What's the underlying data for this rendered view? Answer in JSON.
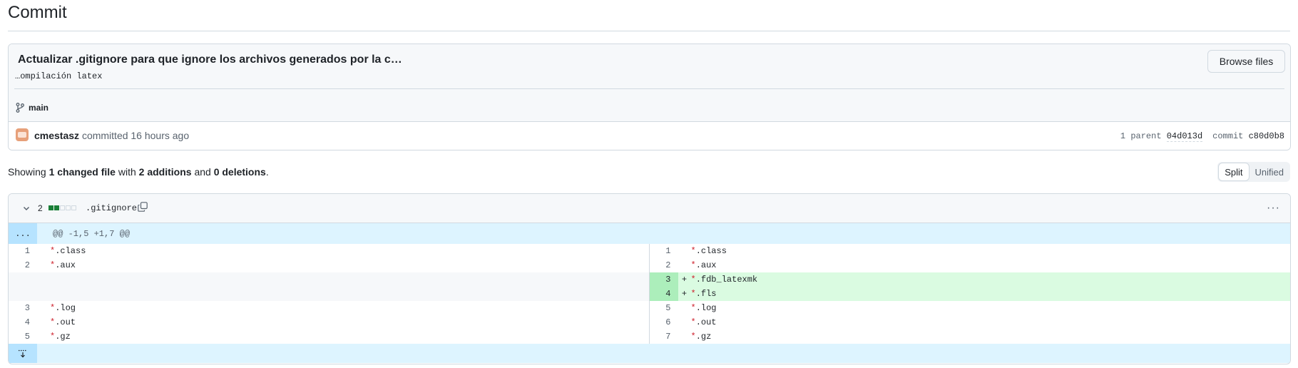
{
  "page": {
    "title": "Commit"
  },
  "commit": {
    "title": "Actualizar .gitignore para que ignore los archivos generados por la c…",
    "description": "…ompilación latex",
    "browse_files_label": "Browse files",
    "branch": "main",
    "author": "cmestasz",
    "action_text": "committed 16 hours ago",
    "parent_label": "1 parent",
    "parent_sha": "04d013d",
    "commit_label": "commit",
    "commit_sha": "c80d0b8"
  },
  "summary": {
    "prefix": "Showing",
    "changed": "1 changed file",
    "with": "with",
    "additions": "2 additions",
    "and": "and",
    "deletions": "0 deletions",
    "suffix": "."
  },
  "view_toggle": {
    "split_label": "Split",
    "unified_label": "Unified",
    "selected": "Split"
  },
  "file": {
    "change_count": "2",
    "diffstat": [
      "add",
      "add",
      "neutral",
      "neutral",
      "neutral"
    ],
    "name": ".gitignore",
    "menu_icon": "kebab-horizontal-icon",
    "hunk_expander": "...",
    "hunk_header": "@@ -1,5 +1,7 @@",
    "rows": [
      {
        "type": "context",
        "left_ln": "1",
        "left_star": "*",
        "left_text": ".class",
        "right_ln": "1",
        "right_star": "*",
        "right_text": ".class",
        "right_marker": ""
      },
      {
        "type": "context",
        "left_ln": "2",
        "left_star": "*",
        "left_text": ".aux",
        "right_ln": "2",
        "right_star": "*",
        "right_text": ".aux",
        "right_marker": ""
      },
      {
        "type": "added",
        "left_ln": "",
        "left_star": "",
        "left_text": "",
        "right_ln": "3",
        "right_star": "*",
        "right_text": ".fdb_latexmk",
        "right_marker": "+"
      },
      {
        "type": "added",
        "left_ln": "",
        "left_star": "",
        "left_text": "",
        "right_ln": "4",
        "right_star": "*",
        "right_text": ".fls",
        "right_marker": "+"
      },
      {
        "type": "context",
        "left_ln": "3",
        "left_star": "*",
        "left_text": ".log",
        "right_ln": "5",
        "right_star": "*",
        "right_text": ".log",
        "right_marker": ""
      },
      {
        "type": "context",
        "left_ln": "4",
        "left_star": "*",
        "left_text": ".out",
        "right_ln": "6",
        "right_star": "*",
        "right_text": ".out",
        "right_marker": ""
      },
      {
        "type": "context",
        "left_ln": "5",
        "left_star": "*",
        "left_text": ".gz",
        "right_ln": "7",
        "right_star": "*",
        "right_text": ".gz",
        "right_marker": ""
      }
    ]
  },
  "colors": {
    "addition": "#1a7f37",
    "added_bg": "#dafbe1",
    "hunk_bg": "#ddf4ff",
    "star": "#cf222e"
  }
}
